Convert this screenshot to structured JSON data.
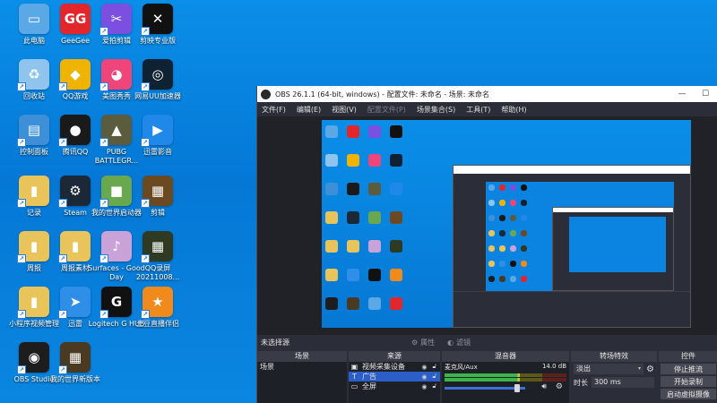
{
  "desktop": {
    "icons": [
      {
        "label": "此电脑",
        "icon": "computer-icon",
        "color": "#5aa9e6"
      },
      {
        "label": "GeeGee",
        "icon": "geegee-icon",
        "color": "#e2262c"
      },
      {
        "label": "爱拍剪辑",
        "icon": "scissors-icon",
        "color": "#7b4fe0"
      },
      {
        "label": "剪映专业版",
        "icon": "capcut-icon",
        "color": "#111111"
      },
      {
        "label": "回收站",
        "icon": "recycle-bin-icon",
        "color": "#8fc4ee"
      },
      {
        "label": "QQ游戏",
        "icon": "qq-game-icon",
        "color": "#f0b400"
      },
      {
        "label": "美图秀秀",
        "icon": "meitu-icon",
        "color": "#f0457a"
      },
      {
        "label": "网易UU加速器",
        "icon": "uu-accelerator-icon",
        "color": "#0f2233"
      },
      {
        "label": "控制面板",
        "icon": "control-panel-icon",
        "color": "#3d8fd8"
      },
      {
        "label": "腾讯QQ",
        "icon": "qq-penguin-icon",
        "color": "#1a1a1a"
      },
      {
        "label": "PUBG BATTLEGR...",
        "icon": "pubg-icon",
        "color": "#5b5b3e"
      },
      {
        "label": "迅雷影音",
        "icon": "xunlei-player-icon",
        "color": "#1f88e8"
      },
      {
        "label": "记录",
        "icon": "folder-icon",
        "color": "#e8c45a"
      },
      {
        "label": "Steam",
        "icon": "steam-icon",
        "color": "#1b2838"
      },
      {
        "label": "我的世界启动器",
        "icon": "minecraft-icon",
        "color": "#6aa84f"
      },
      {
        "label": "剪辑",
        "icon": "video-thumb-icon",
        "color": "#6b4a22"
      },
      {
        "label": "周报",
        "icon": "folder-icon",
        "color": "#e8c45a"
      },
      {
        "label": "周报素材",
        "icon": "folder-icon",
        "color": "#e8c45a"
      },
      {
        "label": "Surfaces - Good Day",
        "icon": "music-cover-icon",
        "color": "#c9a2d8"
      },
      {
        "label": "QQ录屏20211008...",
        "icon": "video-thumb-icon",
        "color": "#2f3a22"
      },
      {
        "label": "小程序视频管理",
        "icon": "folder-icon",
        "color": "#e8c45a"
      },
      {
        "label": "迅雷",
        "icon": "xunlei-bird-icon",
        "color": "#2f8fe8"
      },
      {
        "label": "Logitech G HUB",
        "icon": "logitech-g-icon",
        "color": "#111111"
      },
      {
        "label": "土豆直播伴侣",
        "icon": "live-companion-icon",
        "color": "#f08a1c"
      },
      {
        "label": "OBS Studio",
        "icon": "obs-icon",
        "color": "#1d1d1d"
      },
      {
        "label": "我的世界新版本",
        "icon": "video-thumb-icon",
        "color": "#4a3a22"
      }
    ]
  },
  "obs": {
    "title": "OBS 26.1.1 (64-bit, windows) - 配置文件: 未命名 - 场景: 未命名",
    "window_controls": [
      "—",
      "☐"
    ],
    "menu": [
      {
        "label": "文件(F)",
        "enabled": true
      },
      {
        "label": "编辑(E)",
        "enabled": true
      },
      {
        "label": "视图(V)",
        "enabled": true
      },
      {
        "label": "配置文件(P)",
        "enabled": false
      },
      {
        "label": "场景集合(S)",
        "enabled": true
      },
      {
        "label": "工具(T)",
        "enabled": true
      },
      {
        "label": "帮助(H)",
        "enabled": true
      }
    ],
    "status_strip": {
      "no_source": "未选择源",
      "properties": "属性",
      "filters": "滤镜"
    },
    "docks": {
      "scenes": {
        "title": "场景",
        "items": [
          "场景"
        ]
      },
      "sources": {
        "title": "来源",
        "items": [
          {
            "label": "视频采集设备",
            "icon": "camera-icon",
            "selected": false
          },
          {
            "label": "广告",
            "icon": "text-icon",
            "selected": true
          },
          {
            "label": "全屏",
            "icon": "monitor-icon",
            "selected": false
          }
        ]
      },
      "mixer": {
        "title": "混音器",
        "channel": "麦克风/Aux",
        "level": "14.0 dB",
        "volume": 0.9,
        "meter_level": 0.62
      },
      "transitions": {
        "title": "转场特效",
        "type": "淡出",
        "duration_label": "时长",
        "duration_value": "300 ms"
      },
      "controls": {
        "title": "控件",
        "buttons": [
          "停止推流",
          "开始录制",
          "启动虚拟摄像"
        ]
      }
    }
  }
}
